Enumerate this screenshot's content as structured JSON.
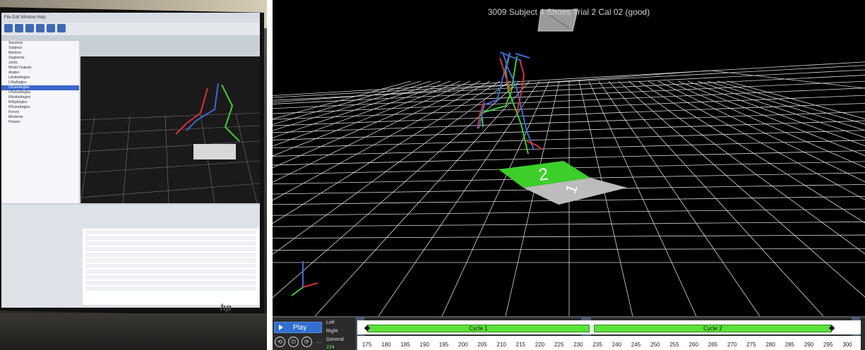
{
  "viewport": {
    "title": "3009 Subject 4 Shoes Trial 2 Cal 02 (good)",
    "plate_labels": [
      "2",
      "1"
    ]
  },
  "timeline": {
    "play_label": "Play",
    "rows": [
      "Left",
      "Right",
      "General"
    ],
    "current_frame": "234",
    "cycles": [
      {
        "label": "Cycle 1",
        "start": 175,
        "end": 233
      },
      {
        "label": "Cycle 2",
        "start": 234,
        "end": 296
      }
    ],
    "ticks": [
      "175",
      "180",
      "185",
      "190",
      "195",
      "200",
      "205",
      "210",
      "215",
      "220",
      "225",
      "230",
      "235",
      "240",
      "245",
      "250",
      "255",
      "260",
      "265",
      "270",
      "275",
      "280",
      "285",
      "290",
      "295",
      "300"
    ],
    "icons": [
      "back-icon",
      "power-icon",
      "forward-icon",
      "more-icon"
    ]
  },
  "colors": {
    "accent_blue": "#2f6fd0",
    "cycle_green": "#5be23a",
    "plate_green": "#3ccf2a",
    "plate_gray": "#bcbcbc",
    "grid": "#d8d8d8"
  },
  "photo_screen": {
    "tree_items": [
      "Sessions",
      "Subjects",
      "Markers",
      "Segments",
      "Joints",
      "Model Outputs",
      "Angles",
      "LAnkleAngles",
      "LHipAngles",
      "LKneeAngles",
      "LPelvisAngles",
      "RAnkleAngles",
      "RHipAngles",
      "RKneeAngles",
      "Forces",
      "Moments",
      "Powers"
    ],
    "selected_item": "LKneeAngles"
  }
}
